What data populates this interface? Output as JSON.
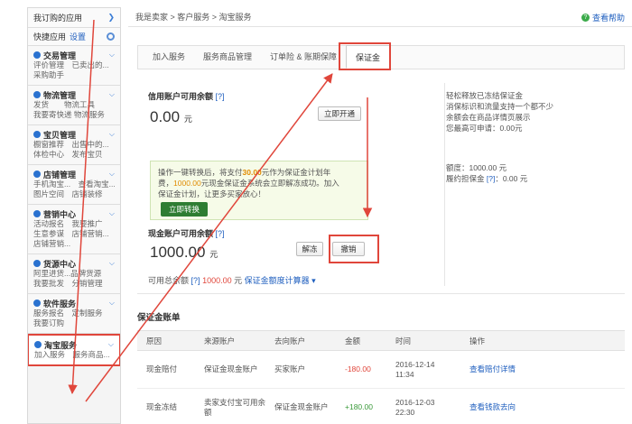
{
  "sidebar": {
    "top_label": "我订购的应用",
    "quick_label": "快捷应用",
    "quick_settings": "设置",
    "sections": [
      {
        "title": "交易管理",
        "lines": [
          "评价管理　已卖出的...",
          "采购助手"
        ]
      },
      {
        "title": "物流管理",
        "lines": [
          "发货　　物流工具",
          "我要寄快递 物流服务"
        ]
      },
      {
        "title": "宝贝管理",
        "lines": [
          "橱窗推荐　出售中的...",
          "体检中心　发布宝贝"
        ]
      },
      {
        "title": "店铺管理",
        "lines": [
          "手机淘宝...　查看淘宝...",
          "图片空间　店铺装修"
        ]
      },
      {
        "title": "营销中心",
        "lines": [
          "活动报名　我要推广",
          "生意参谋　店铺营销...",
          "店铺营销..."
        ]
      },
      {
        "title": "货源中心",
        "lines": [
          "阿里进货...品牌货源",
          "我要批发　分销管理"
        ]
      },
      {
        "title": "软件服务",
        "lines": [
          "服务报名　定制服务",
          "我要订购"
        ]
      },
      {
        "title": "淘宝服务",
        "lines": [
          "加入服务　服务商品..."
        ]
      }
    ]
  },
  "breadcrumb": "我是卖家 > 客户服务 > 淘宝服务",
  "help_label": "查看帮助",
  "tabs": [
    "加入服务",
    "服务商品管理",
    "订单险 & 账期保障",
    "保证金"
  ],
  "credit": {
    "label": "信用账户可用余额",
    "q": "[?]",
    "amount": "0.00",
    "unit": "元",
    "open_button": "立即开通"
  },
  "promo": {
    "line1a": "操作一键转换后，将支付",
    "line1b": "30.00",
    "line1c": "元作为保证金计划年",
    "line2a": "费，",
    "line2b": "1000.00",
    "line2c": "元现金保证金系统会立即解冻成功。加入",
    "line3": "保证金计划，让更多买家放心！",
    "button": "立即转换"
  },
  "cash": {
    "label": "现金账户可用余额",
    "q": "[?]",
    "amount": "1000.00",
    "unit": "元",
    "unfreeze_button": "解冻",
    "withdraw_button": "撤销"
  },
  "available": {
    "label": "可用总余额",
    "q": "[?]",
    "amount": "1000.00",
    "unit": "元",
    "calc": "保证金额度计算器 ▾"
  },
  "right_info": {
    "lines": [
      "轻松释放已冻结保证金",
      "消保标识和流量支持一个都不少",
      "余额会在商品详情页展示",
      "您最高可申请：0.00元"
    ],
    "quota_label": "额度：1000.00 元",
    "perf_label": "履约担保金",
    "perf_q": "[?]",
    "perf_value": "：0.00 元"
  },
  "ledger": {
    "title": "保证金账单",
    "headers": [
      "原因",
      "来源账户",
      "去向账户",
      "金额",
      "时间",
      "操作"
    ],
    "rows": [
      {
        "reason": "现金赔付",
        "from": "保证金现金账户",
        "to": "买家账户",
        "amount": "-180.00",
        "time1": "2016-12-14",
        "time2": "11:34",
        "op": "查看赔付详情"
      },
      {
        "reason": "现金冻结",
        "from": "卖家支付宝可用余额",
        "to": "保证金现金账户",
        "amount": "+180.00",
        "time1": "2016-12-03",
        "time2": "22:30",
        "op": "查看钱款去向"
      }
    ]
  },
  "colors": {
    "accent_red": "#e0463b",
    "link_blue": "#1f5fbf",
    "button_green": "#2e7d32"
  }
}
